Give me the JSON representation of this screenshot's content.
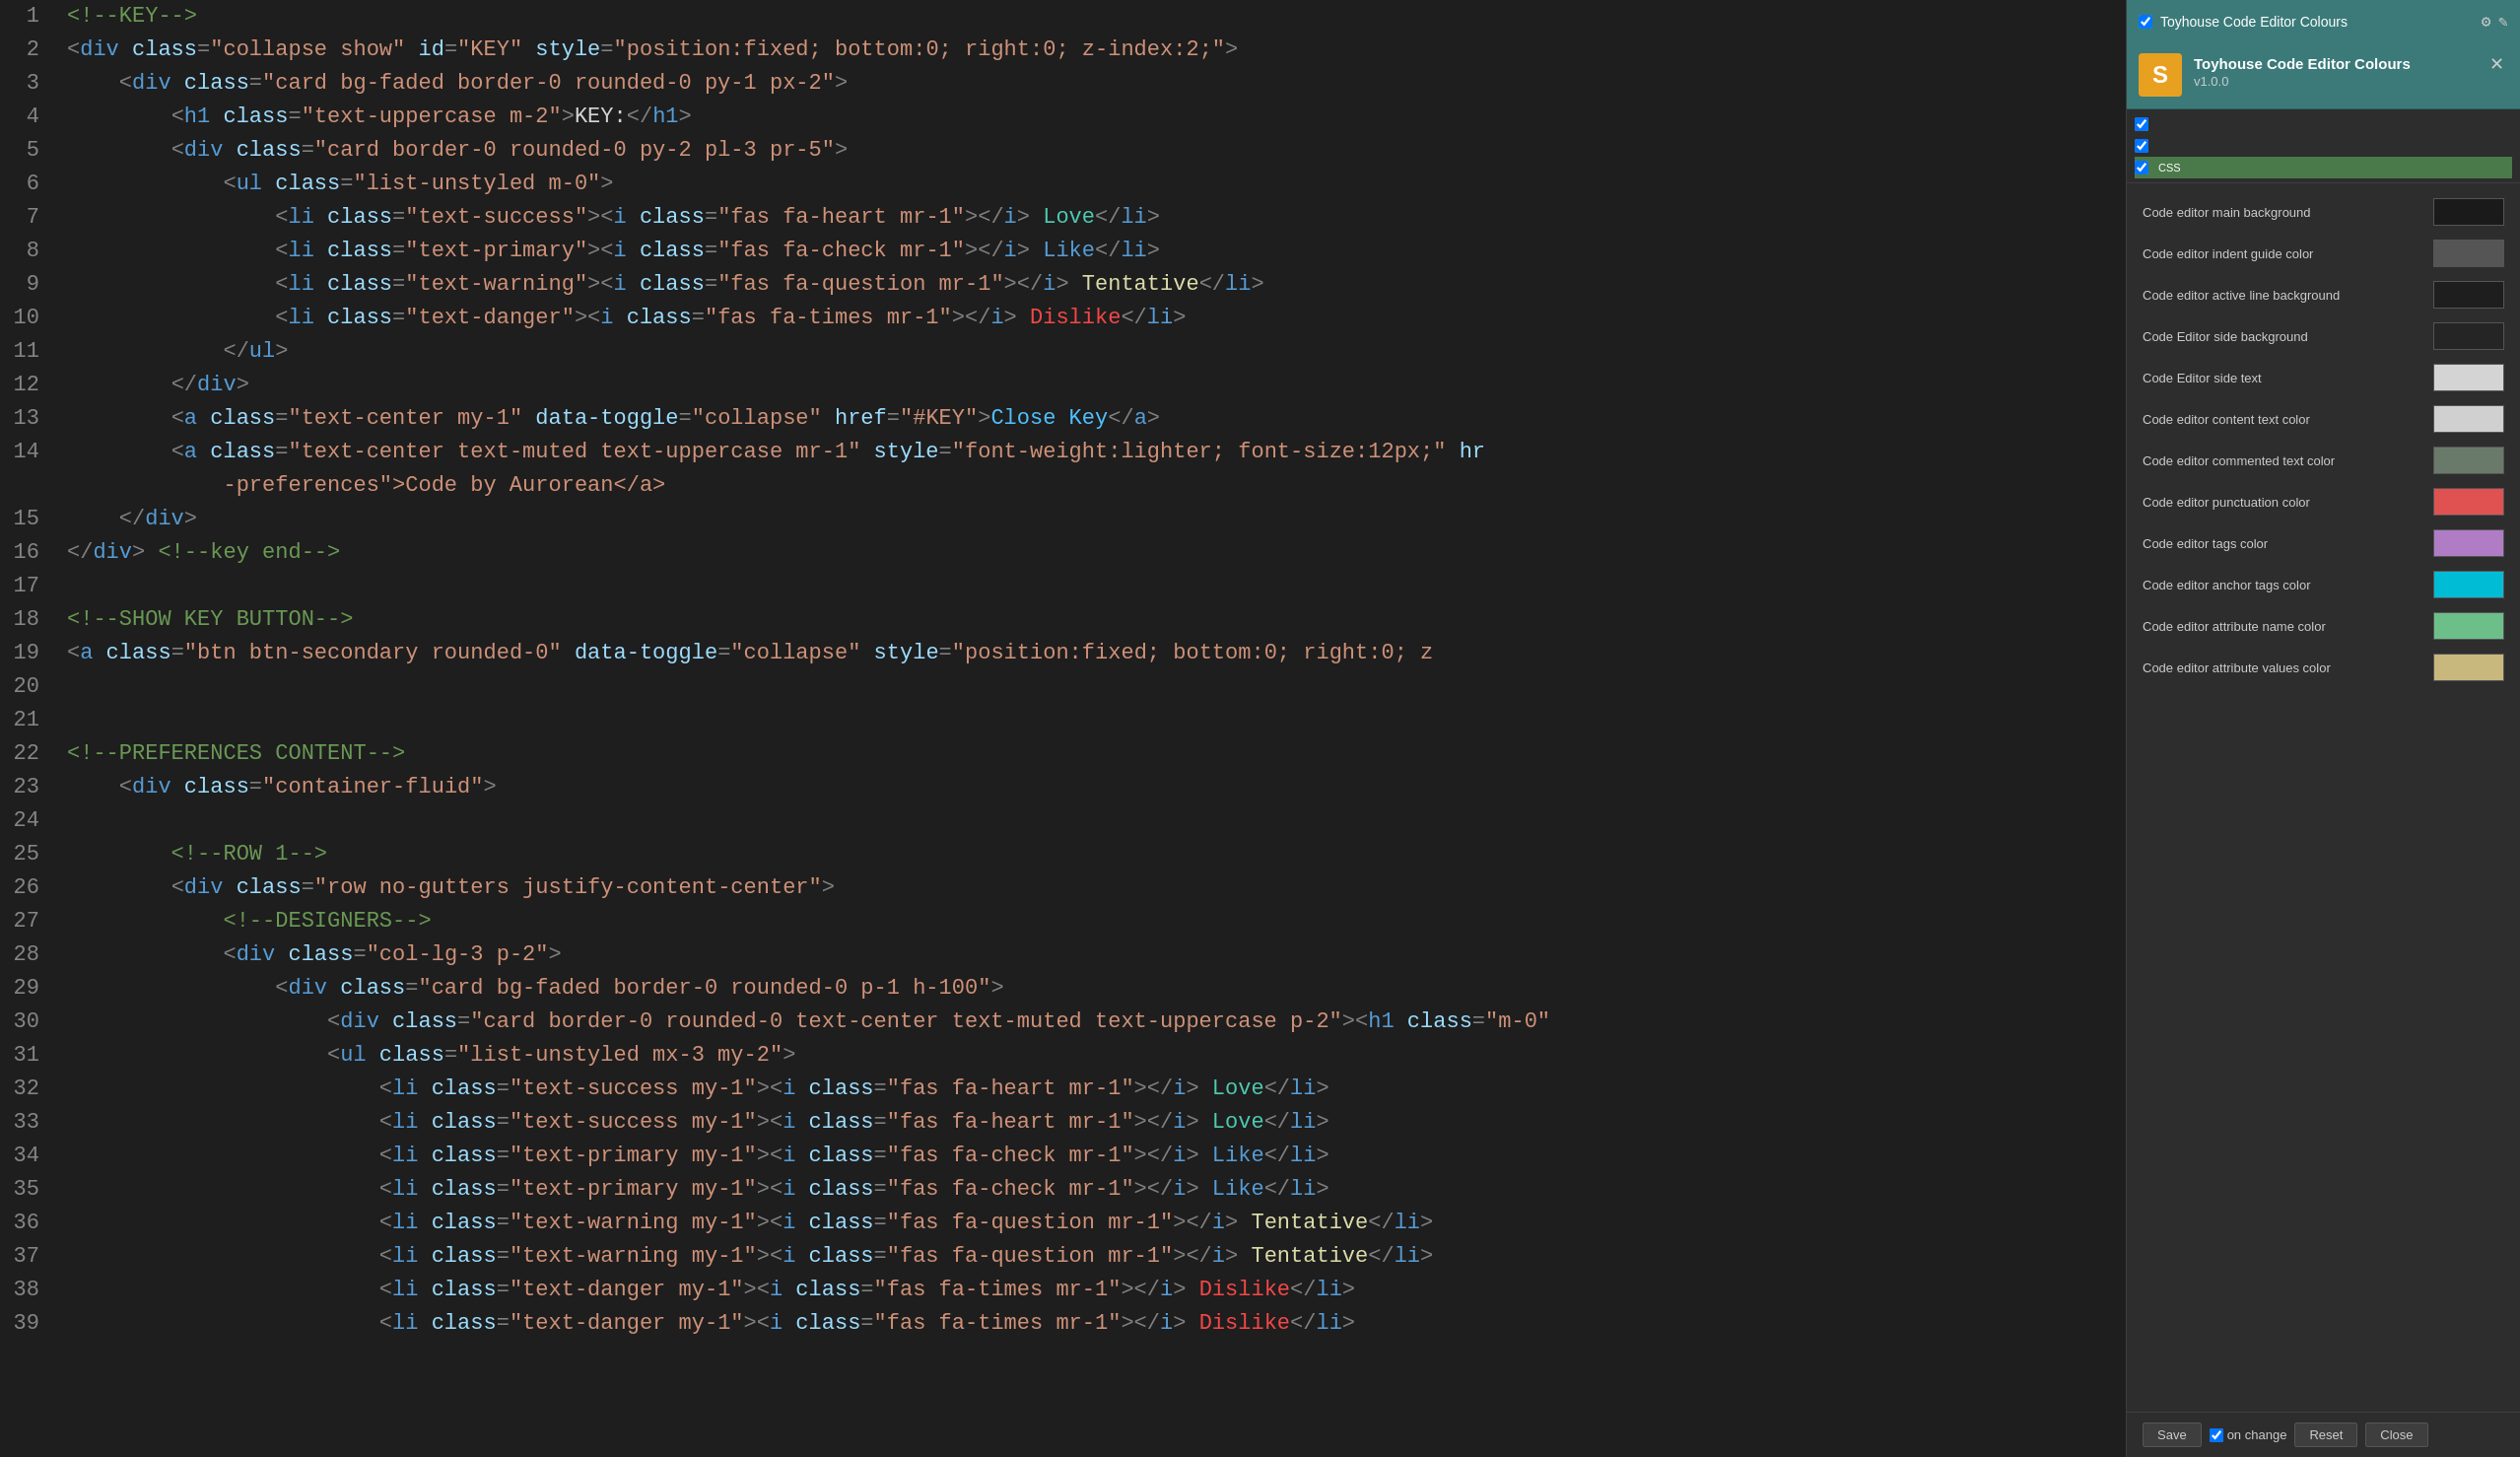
{
  "editor": {
    "lines": [
      {
        "num": 1,
        "content": "<!--KEY-->",
        "type": "comment",
        "active": false
      },
      {
        "num": 2,
        "content": "<div class=\"collapse show\" id=\"KEY\" style=\"position:fixed; bottom:0; right:0; z-index:2;\">",
        "active": false
      },
      {
        "num": 3,
        "content": "    <div class=\"card bg-faded border-0 rounded-0 py-1 px-2\">",
        "active": false
      },
      {
        "num": 4,
        "content": "        <h1 class=\"text-uppercase m-2\">KEY:</h1>",
        "active": false
      },
      {
        "num": 5,
        "content": "        <div class=\"card border-0 rounded-0 py-2 pl-3 pr-5\">",
        "active": false
      },
      {
        "num": 6,
        "content": "            <ul class=\"list-unstyled m-0\">",
        "active": false
      },
      {
        "num": 7,
        "content": "                <li class=\"text-success\"><i class=\"fas fa-heart mr-1\"></i> Love</li>",
        "active": false
      },
      {
        "num": 8,
        "content": "                <li class=\"text-primary\"><i class=\"fas fa-check mr-1\"></i> Like</li>",
        "active": false
      },
      {
        "num": 9,
        "content": "                <li class=\"text-warning\"><i class=\"fas fa-question mr-1\"></i> Tentative</li>",
        "active": false
      },
      {
        "num": 10,
        "content": "                <li class=\"text-danger\"><i class=\"fas fa-times mr-1\"></i> Dislike</li>",
        "active": false
      },
      {
        "num": 11,
        "content": "            </ul>",
        "active": false
      },
      {
        "num": 12,
        "content": "        </div>",
        "active": false
      },
      {
        "num": 13,
        "content": "        <a class=\"text-center my-1\" data-toggle=\"collapse\" href=\"#KEY\">Close Key</a>",
        "active": false
      },
      {
        "num": 14,
        "content": "        <a class=\"text-center text-muted text-uppercase mr-1\" style=\"font-weight:lighter; font-size:12px;\" hr",
        "continuation": "            -preferences\">Code by Aurorean</a>",
        "multi": true,
        "active": false
      },
      {
        "num": 15,
        "content": "    </div>",
        "active": false
      },
      {
        "num": 16,
        "content": "</div> <!--key end-->",
        "active": false
      },
      {
        "num": 17,
        "content": "",
        "active": false
      },
      {
        "num": 18,
        "content": "<!--SHOW KEY BUTTON-->",
        "type": "comment",
        "active": false
      },
      {
        "num": 19,
        "content": "<a class=\"btn btn-secondary rounded-0\" data-toggle=\"collapse\" style=\"position:fixed; bottom:0; right:0; z",
        "active": false
      },
      {
        "num": 20,
        "content": "",
        "active": false
      },
      {
        "num": 21,
        "content": "",
        "active": false
      },
      {
        "num": 22,
        "content": "<!--PREFERENCES CONTENT-->",
        "type": "comment",
        "active": false
      },
      {
        "num": 23,
        "content": "    <div class=\"container-fluid\">",
        "active": false
      },
      {
        "num": 24,
        "content": "",
        "active": false
      },
      {
        "num": 25,
        "content": "        <!--ROW 1-->",
        "type": "comment",
        "active": false
      },
      {
        "num": 26,
        "content": "        <div class=\"row no-gutters justify-content-center\">",
        "active": false
      },
      {
        "num": 27,
        "content": "            <!--DESIGNERS-->",
        "type": "comment",
        "active": false
      },
      {
        "num": 28,
        "content": "            <div class=\"col-lg-3 p-2\">",
        "active": false
      },
      {
        "num": 29,
        "content": "                <div class=\"card bg-faded border-0 rounded-0 p-1 h-100\">",
        "active": false
      },
      {
        "num": 30,
        "content": "                    <div class=\"card border-0 rounded-0 text-center text-muted text-uppercase p-2\"><h1 class=\"m-0\"",
        "active": false
      },
      {
        "num": 31,
        "content": "                    <ul class=\"list-unstyled mx-3 my-2\">",
        "active": false
      },
      {
        "num": 32,
        "content": "                        <li class=\"text-success my-1\"><i class=\"fas fa-heart mr-1\"></i> Love</li>",
        "active": false
      },
      {
        "num": 33,
        "content": "                        <li class=\"text-success my-1\"><i class=\"fas fa-heart mr-1\"></i> Love</li>",
        "active": false
      },
      {
        "num": 34,
        "content": "                        <li class=\"text-primary my-1\"><i class=\"fas fa-check mr-1\"></i> Like</li>",
        "active": false
      },
      {
        "num": 35,
        "content": "                        <li class=\"text-primary my-1\"><i class=\"fas fa-check mr-1\"></i> Like</li>",
        "active": false
      },
      {
        "num": 36,
        "content": "                        <li class=\"text-warning my-1\"><i class=\"fas fa-question mr-1\"></i> Tentative</li>",
        "active": false
      },
      {
        "num": 37,
        "content": "                        <li class=\"text-warning my-1\"><i class=\"fas fa-question mr-1\"></i> Tentative</li>",
        "active": false
      },
      {
        "num": 38,
        "content": "                        <li class=\"text-danger my-1\"><i class=\"fas fa-times mr-1\"></i> Dislike</li>",
        "active": false
      },
      {
        "num": 39,
        "content": "                        <li class=\"text-danger my-1\"><i class=\"fas fa-times mr-1\"></i> Dislike</li>",
        "active": false
      }
    ]
  },
  "panel": {
    "header_title": "Toyhouse Code Editor Colours",
    "plugin_title": "Toyhouse Code Editor Colours",
    "plugin_version": "v1.0.0",
    "color_rows": [
      {
        "label": "Code editor main background",
        "color": "#1a1a1a"
      },
      {
        "label": "Code editor indent guide color",
        "color": "#555555"
      },
      {
        "label": "Code editor active line background",
        "color": "#282828"
      },
      {
        "label": "Code Editor side background",
        "color": "#252525"
      },
      {
        "label": "Code Editor side text",
        "color": "#d4d4d4"
      },
      {
        "label": "Code editor content text color",
        "color": "#d0d0d0"
      },
      {
        "label": "Code editor commented text color",
        "color": "#6a9955"
      },
      {
        "label": "Code editor punctuation color",
        "color": "#e05252"
      },
      {
        "label": "Code editor tags color",
        "color": "#b07cc6"
      },
      {
        "label": "Code editor anchor tags color",
        "color": "#00bcd4"
      },
      {
        "label": "Code editor attribute name color",
        "color": "#6dbf8a"
      },
      {
        "label": "Code editor attribute values color",
        "color": "#c8b87e"
      }
    ],
    "footer": {
      "save_label": "Save",
      "on_change_label": "on change",
      "reset_label": "Reset",
      "close_label": "Close"
    }
  }
}
